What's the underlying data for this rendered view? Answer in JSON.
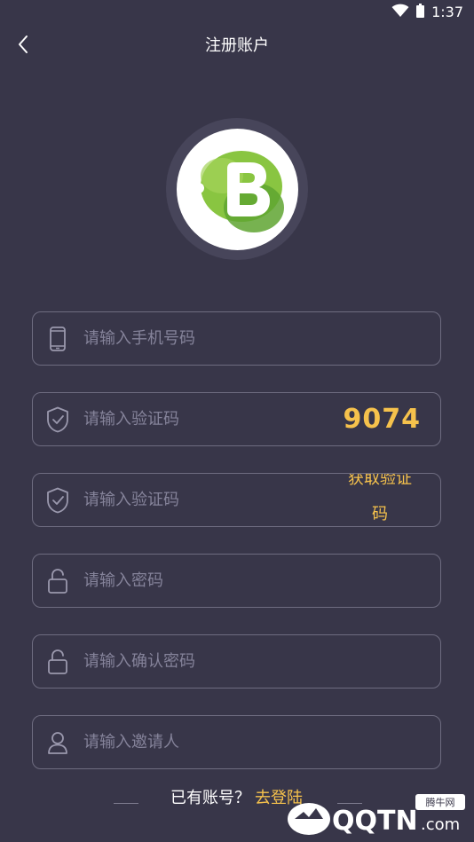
{
  "status_bar": {
    "time": "1:37"
  },
  "header": {
    "title": "注册账户"
  },
  "form": {
    "phone_placeholder": "请输入手机号码",
    "captcha_placeholder": "请输入验证码",
    "captcha_code": "9074",
    "sms_code_placeholder": "请输入验证码",
    "get_code_label": "获取验证码",
    "password_placeholder": "请输入密码",
    "confirm_password_placeholder": "请输入确认密码",
    "inviter_placeholder": "请输入邀请人"
  },
  "footer": {
    "have_account": "已有账号？",
    "go_login": "去登陆"
  },
  "watermark": {
    "text": "QQTN",
    "suffix": ".com",
    "badge": "腾牛网"
  },
  "colors": {
    "background": "#383649",
    "accent": "#f6c24c",
    "field_border": "#6e6c80",
    "placeholder": "#85839a",
    "logo_green": "#7dbe3a"
  },
  "icons": {
    "back": "chevron-left-icon",
    "phone": "phone-icon",
    "captcha": "shield-check-icon",
    "sms": "shield-check-icon",
    "password": "lock-icon",
    "confirm": "lock-icon",
    "inviter": "user-icon"
  }
}
